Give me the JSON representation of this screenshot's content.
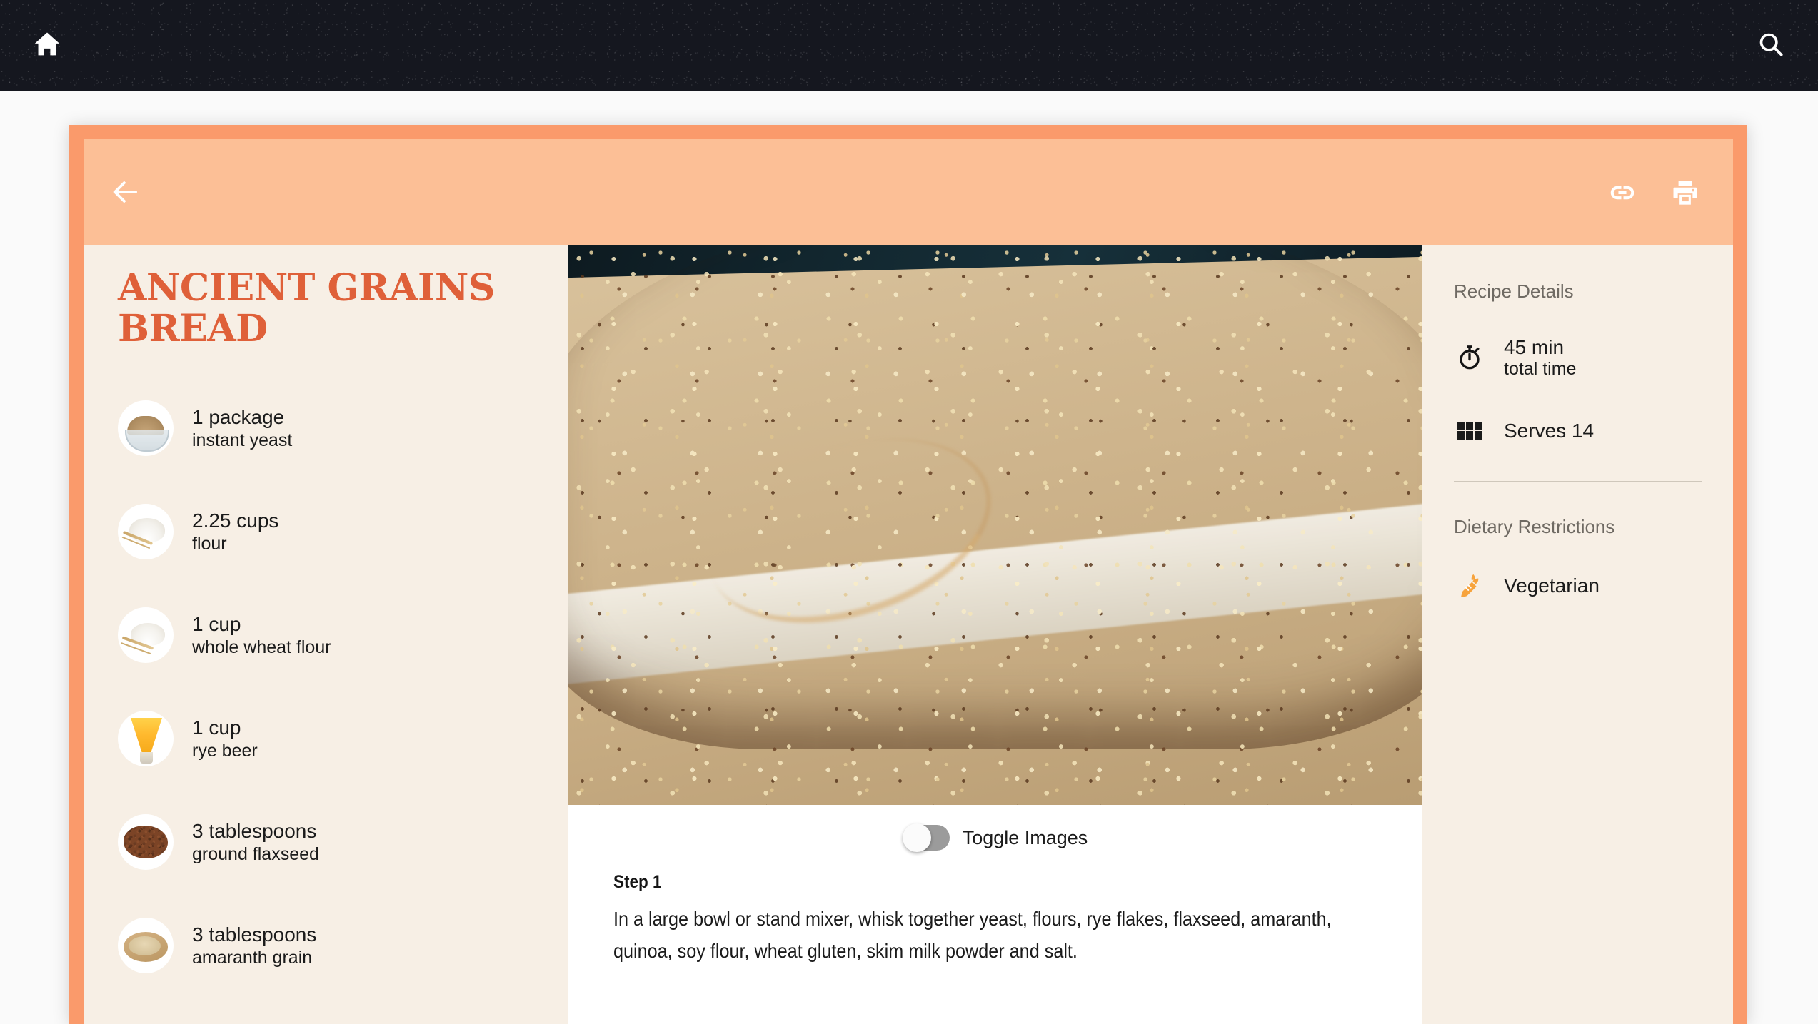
{
  "topbar": {
    "home_icon": "home-icon",
    "search_icon": "search-icon"
  },
  "card_header": {
    "back_icon": "arrow-left-icon",
    "link_icon": "link-icon",
    "print_icon": "printer-icon"
  },
  "recipe": {
    "title": "Ancient Grains Bread",
    "ingredients": [
      {
        "amount": "1 package",
        "name": "instant yeast",
        "icon": "yeast-bowl-icon"
      },
      {
        "amount": "2.25 cups",
        "name": "flour",
        "icon": "flour-pile-icon"
      },
      {
        "amount": "1 cup",
        "name": "whole wheat flour",
        "icon": "whole-wheat-flour-icon"
      },
      {
        "amount": "1 cup",
        "name": "rye beer",
        "icon": "beer-glass-icon"
      },
      {
        "amount": "3 tablespoons",
        "name": "ground flaxseed",
        "icon": "flaxseed-icon"
      },
      {
        "amount": "3 tablespoons",
        "name": "amaranth grain",
        "icon": "amaranth-bowl-icon"
      }
    ],
    "photo_alt": "Loaf of ancient grains bread in a parchment-lined pan"
  },
  "steps_panel": {
    "toggle_label": "Toggle Images",
    "toggle_state": "off",
    "steps": [
      {
        "label": "Step 1",
        "text": "In a large bowl or stand mixer, whisk together yeast, flours, rye flakes, flaxseed, amaranth, quinoa, soy flour, wheat gluten, skim milk powder and salt."
      }
    ]
  },
  "details": {
    "heading": "Recipe Details",
    "time_value": "45 min",
    "time_label": "total time",
    "servings": "Serves 14",
    "dietary_heading": "Dietary Restrictions",
    "dietary": [
      {
        "label": "Vegetarian",
        "icon": "carrot-icon"
      }
    ]
  },
  "colors": {
    "topbar_bg": "#15171f",
    "card_border": "#FA9A6B",
    "card_header_bg": "#FCBF96",
    "panel_bg": "#F7EFE5",
    "title_orange": "#DF6039",
    "page_bg": "#FAFAFA",
    "carrot_orange": "#F7A33C"
  }
}
